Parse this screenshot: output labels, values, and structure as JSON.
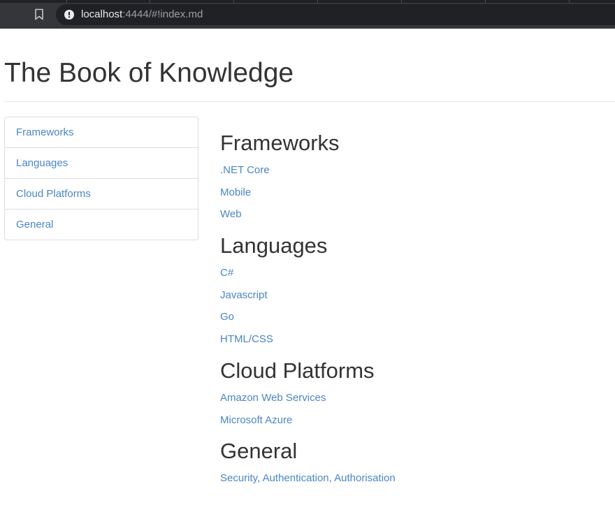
{
  "browser": {
    "url_host": "localhost",
    "url_rest": ":4444/#!index.md"
  },
  "page": {
    "title": "The Book of Knowledge"
  },
  "sidebar": {
    "items": [
      {
        "label": "Frameworks"
      },
      {
        "label": "Languages"
      },
      {
        "label": "Cloud Platforms"
      },
      {
        "label": "General"
      }
    ]
  },
  "sections": [
    {
      "heading": "Frameworks",
      "links": [
        ".NET Core",
        "Mobile",
        "Web"
      ]
    },
    {
      "heading": "Languages",
      "links": [
        "C#",
        "Javascript",
        "Go",
        "HTML/CSS"
      ]
    },
    {
      "heading": "Cloud Platforms",
      "links": [
        "Amazon Web Services",
        "Microsoft Azure"
      ]
    },
    {
      "heading": "General",
      "links": [
        "Security, Authentication, Authorisation"
      ]
    }
  ],
  "colors": {
    "link": "#4a86c5",
    "heading": "#333333",
    "browser_chrome": "#35363a"
  }
}
